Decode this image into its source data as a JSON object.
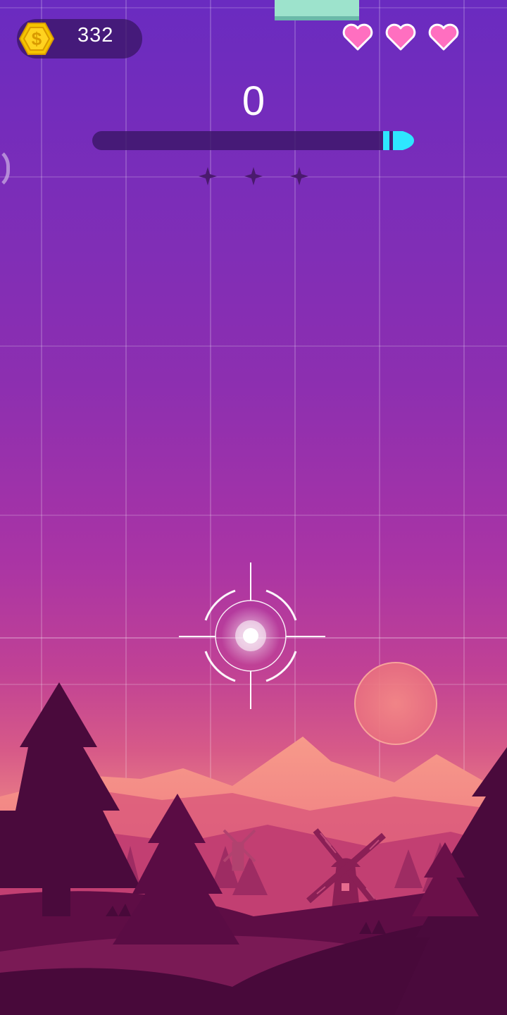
{
  "hud": {
    "coins": "332",
    "score": "0",
    "lives": 3,
    "progress_fraction": 0.0,
    "stars_total": 3,
    "stars_earned": 0
  },
  "icons": {
    "coin": "dollar-coin-icon",
    "heart": "heart-icon",
    "star": "star-icon",
    "crosshair": "crosshair-icon",
    "bullet": "bullet-icon",
    "windmill": "windmill-icon"
  },
  "colors": {
    "sky_top": "#6a2bc0",
    "sky_horizon": "#f49b8c",
    "heart": "#ff6fc0",
    "coin": "#f5c400",
    "bullet": "#2ee6ff",
    "tile": "#9de3cc",
    "silhouette": "#4a0a3c"
  }
}
